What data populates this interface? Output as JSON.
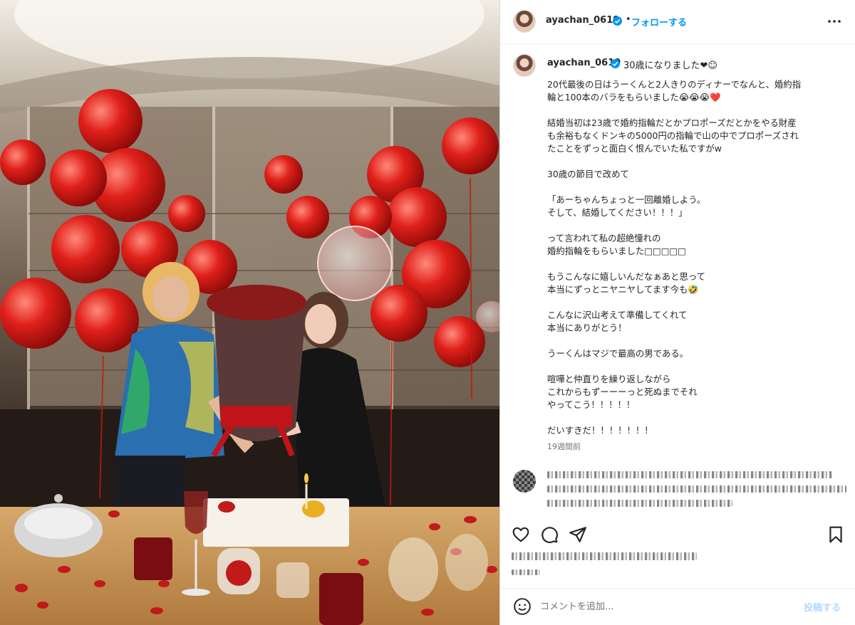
{
  "post": {
    "username": "ayachan_0619",
    "follow_label": "フォローする",
    "dot": "•",
    "caption_first_line": "30歳になりました❤︎☺︎",
    "caption_paragraphs": [
      "20代最後の日はうーくんと2人きりのディナーでなんと、婚約指\n輪と100本のバラをもらいました😭😭😭❤️",
      "結婚当初は23歳で婚約指輪だとかプロポーズだとかをやる財産\nも余裕もなくドンキの5000円の指輪で山の中でプロポーズされ\nたことをずっと面白く恨んでいた私ですがw",
      "30歳の節目で改めて",
      "「あーちゃんちょっと一回離婚しよう。\nそして、結婚してください！！！」",
      "って言われて私の超絶憧れの\n婚約指輪をもらいました□□□□□",
      "もうこんなに嬉しいんだなぁあと思って\n本当にずっとニヤニヤしてます今も🤣",
      "こんなに沢山考えて準備してくれて\n本当にありがとう！",
      "うーくんはマジで最高の男である。",
      "喧嘩と仲直りを繰り返しながら\nこれからもずーーーっと死ぬまでそれ\nやってこう！！！！！",
      "だいすきだ！！！！！！！"
    ],
    "time_ago": "19週間前"
  },
  "actions": {
    "like_icon": "heart-icon",
    "comment_icon": "speech-bubble-icon",
    "share_icon": "paper-plane-icon",
    "save_icon": "bookmark-icon"
  },
  "composer": {
    "placeholder": "コメントを追加...",
    "post_label": "投稿する",
    "emoji_icon": "smiley-icon"
  },
  "colors": {
    "accent": "#0095f6",
    "text": "#262626",
    "muted": "#737373",
    "post_disabled": "#b3dbff"
  }
}
